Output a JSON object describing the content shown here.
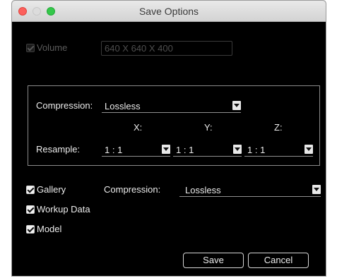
{
  "window": {
    "title": "Save Options"
  },
  "volume": {
    "label": "Volume",
    "value": "640 X 640 X 400",
    "checked": true,
    "enabled": false
  },
  "compression_group": {
    "compression_label": "Compression:",
    "compression_value": "Lossless",
    "axis_x": "X:",
    "axis_y": "Y:",
    "axis_z": "Z:",
    "resample_label": "Resample:",
    "resample_x": "1 : 1",
    "resample_y": "1 : 1",
    "resample_z": "1 : 1"
  },
  "gallery": {
    "label": "Gallery",
    "checked": true,
    "compression_label": "Compression:",
    "compression_value": "Lossless"
  },
  "workup": {
    "label": "Workup Data",
    "checked": true
  },
  "model": {
    "label": "Model",
    "checked": true
  },
  "buttons": {
    "save": "Save",
    "cancel": "Cancel"
  },
  "icons": {
    "close": "close-light-icon",
    "minimize": "minimize-light-icon",
    "maximize": "zoom-light-icon",
    "dropdown": "chevron-down-icon",
    "check": "checkmark-icon"
  },
  "colors": {
    "background": "#000000",
    "close": "#fc605c",
    "zoom": "#34c84a"
  }
}
